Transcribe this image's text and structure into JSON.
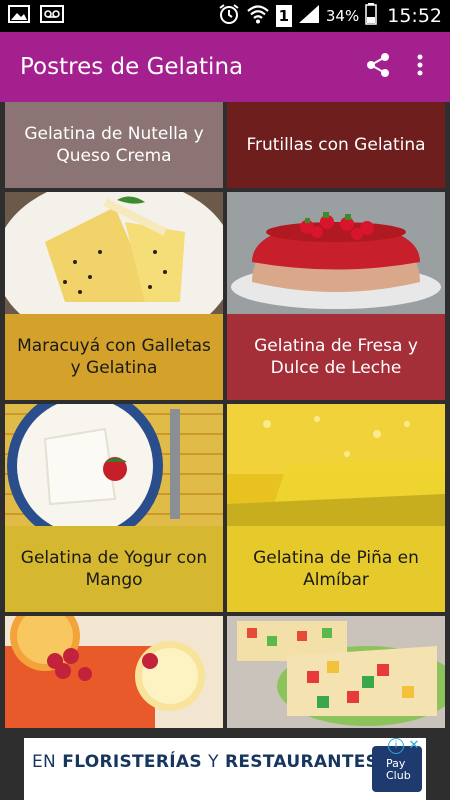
{
  "status_bar": {
    "battery": "34%",
    "sim": "1",
    "time": "15:52"
  },
  "app_bar": {
    "title": "Postres de Gelatina",
    "share_icon": "share-icon",
    "menu_icon": "more-vert-icon"
  },
  "recipes": [
    {
      "title": "Gelatina de Nutella y Queso Crema",
      "color": "#8c7474",
      "text_color": "#ffffff"
    },
    {
      "title": "Frutillas con Gelatina",
      "color": "#6f1e1e",
      "text_color": "#ffffff"
    },
    {
      "title": "Maracuyá con Galletas y Gelatina",
      "color": "#d4a12a",
      "text_color": "#1a1a1a"
    },
    {
      "title": "Gelatina de Fresa y Dulce de Leche",
      "color": "#a42f38",
      "text_color": "#ffffff"
    },
    {
      "title": "Gelatina de Yogur con Mango",
      "color": "#d6b830",
      "text_color": "#1a1a1a"
    },
    {
      "title": "Gelatina de Piña en Almíbar",
      "color": "#e6c92a",
      "text_color": "#1a1a1a"
    },
    {
      "title": "",
      "color": "#e96a3a",
      "text_color": "#1a1a1a"
    },
    {
      "title": "",
      "color": "#9acb57",
      "text_color": "#1a1a1a"
    }
  ],
  "ad": {
    "text_prefix": "EN",
    "text_bold_1": "FLORISTERÍAS",
    "text_light": "Y",
    "text_bold_2": "RESTAURANTES",
    "logo_line_1": "Pay",
    "logo_line_2": "Club"
  }
}
